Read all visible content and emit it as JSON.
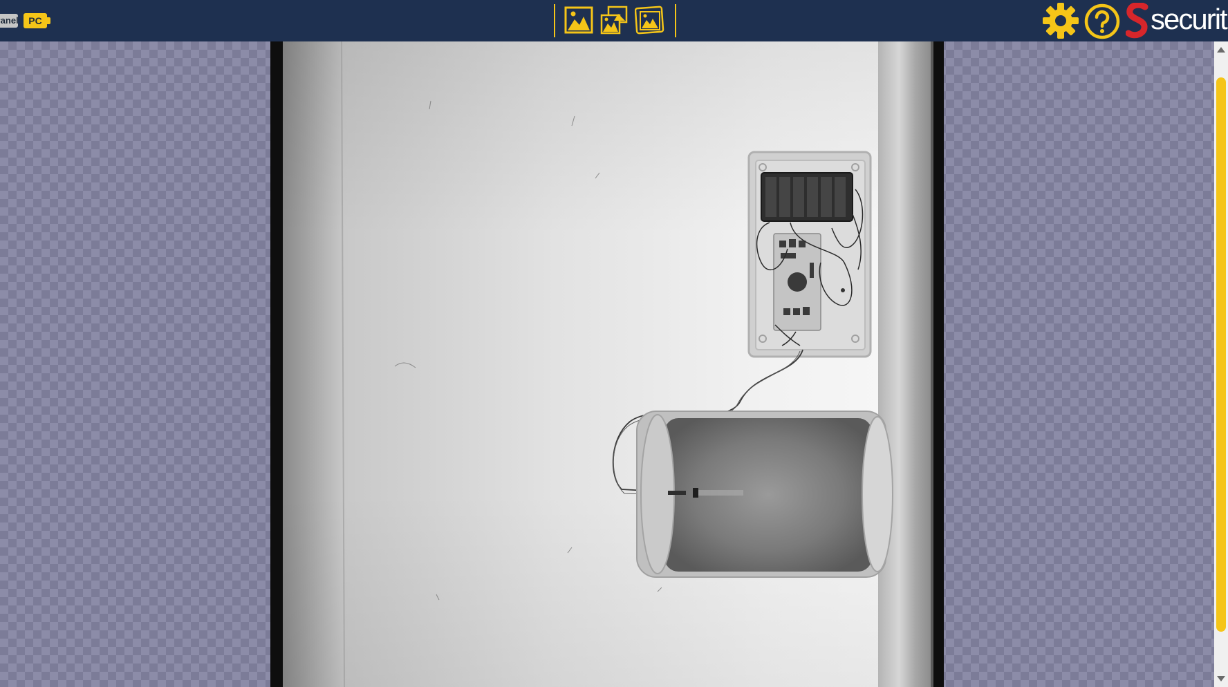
{
  "topbar": {
    "tabs": [
      {
        "label": "Panel",
        "state": "inactive"
      },
      {
        "label": "PC",
        "state": "active"
      }
    ],
    "view_buttons": [
      {
        "icon": "single-image-icon"
      },
      {
        "icon": "multi-image-icon"
      },
      {
        "icon": "image-frame-icon"
      }
    ],
    "settings_icon": "gear-icon",
    "help_icon": "help-circle-icon",
    "logo_text": "securit"
  },
  "viewer": {
    "image_content": "x-ray-scan"
  },
  "colors": {
    "topbar": "#1e3050",
    "accent": "#f5c518",
    "logo_red": "#d7262b",
    "checker_light": "#8c8ca8",
    "checker_dark": "#7c7c98"
  }
}
